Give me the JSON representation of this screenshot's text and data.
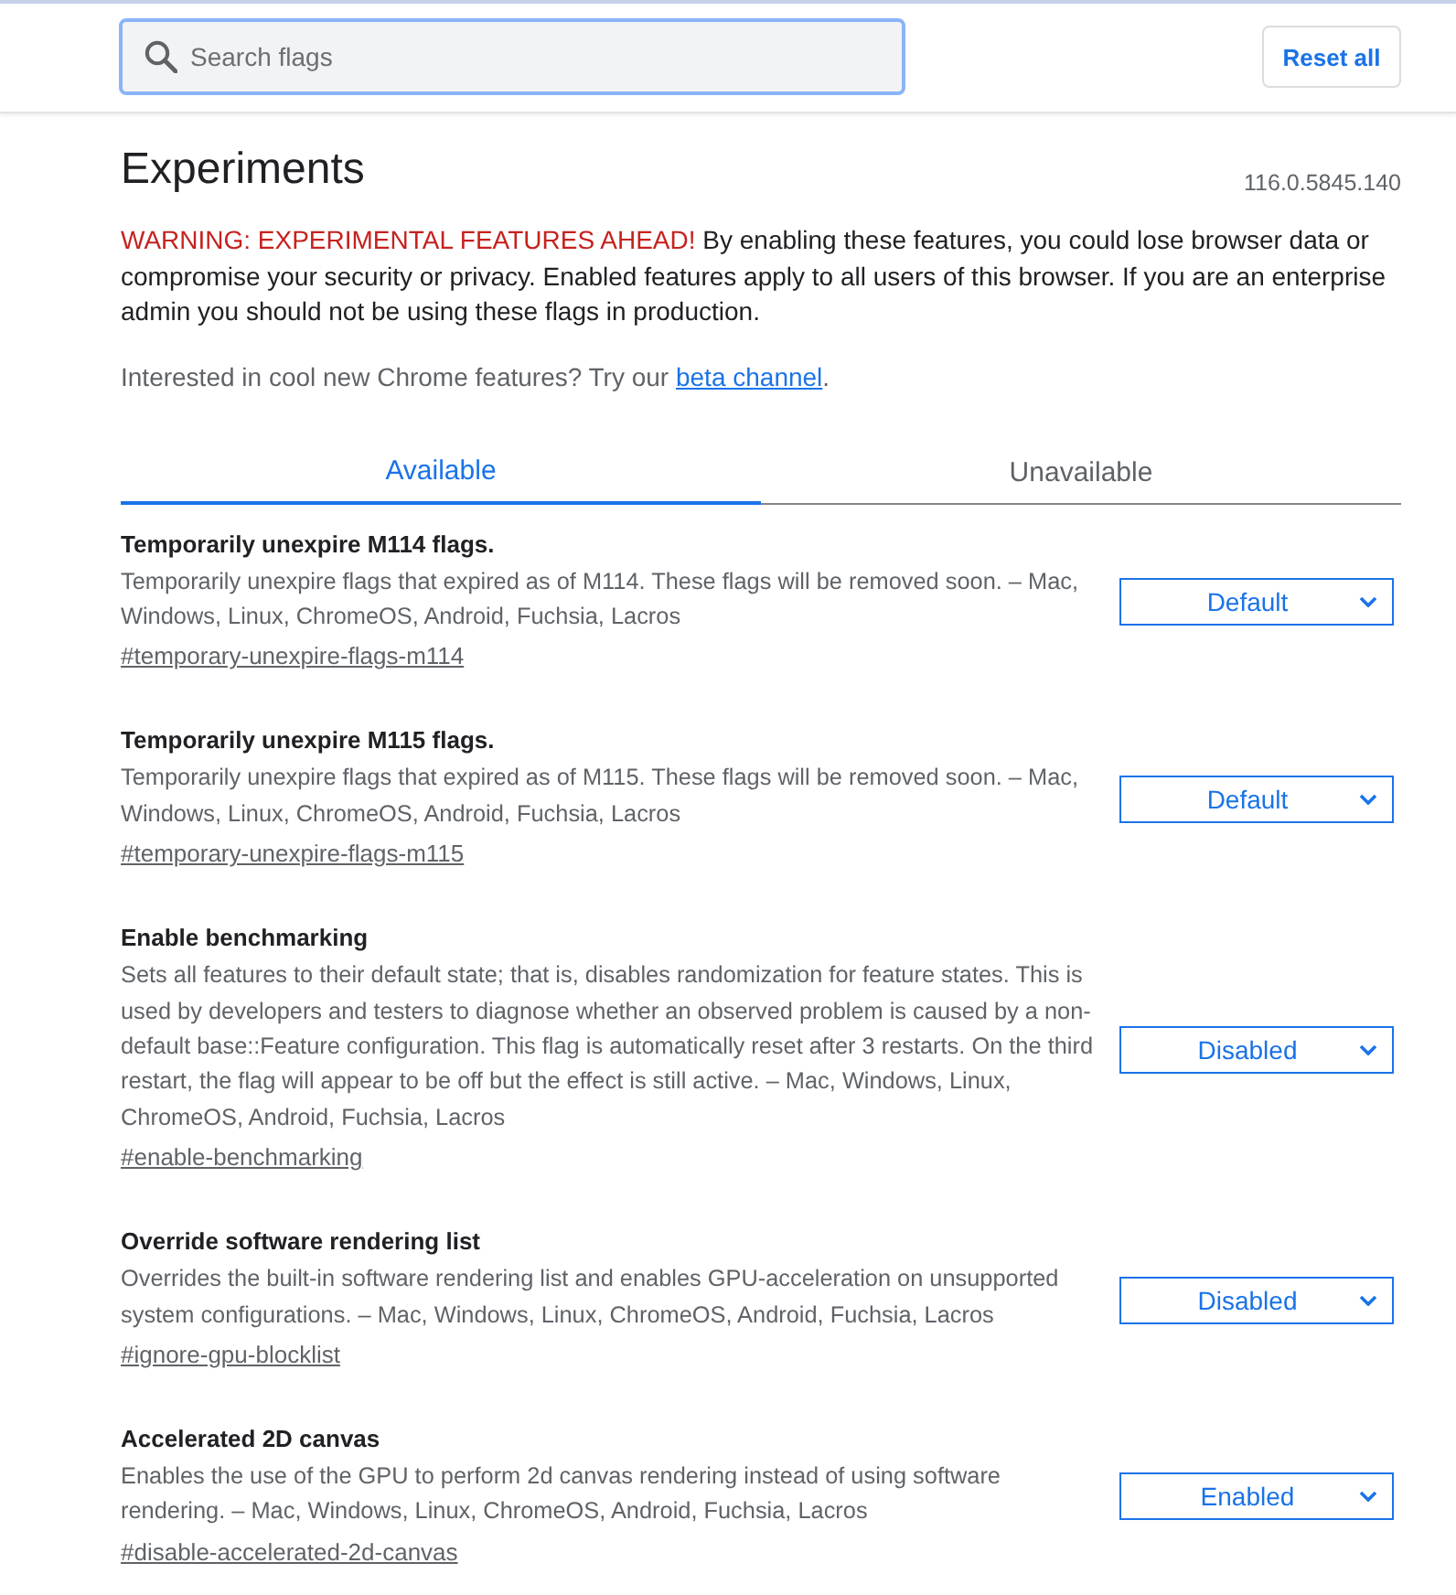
{
  "search": {
    "placeholder": "Search flags",
    "focused": true
  },
  "reset_button": "Reset all",
  "header": {
    "title": "Experiments",
    "version": "116.0.5845.140"
  },
  "warning": {
    "label": "WARNING: EXPERIMENTAL FEATURES AHEAD!",
    "text": "By enabling these features, you could lose browser data or compromise your security or privacy. Enabled features apply to all users of this browser. If you are an enterprise admin you should not be using these flags in production."
  },
  "promo": {
    "text": "Interested in cool new Chrome features? Try our",
    "link": "beta channel",
    "after": "."
  },
  "tabs": [
    {
      "label": "Available",
      "selected": true
    },
    {
      "label": "Unavailable",
      "selected": false
    }
  ],
  "flags": [
    {
      "title": "Temporarily unexpire M114 flags.",
      "description": "Temporarily unexpire flags that expired as of M114. These flags will be removed soon. – Mac, Windows, Linux, ChromeOS, Android, Fuchsia, Lacros",
      "link": "#temporary-unexpire-flags-m114",
      "value": "Default"
    },
    {
      "title": "Temporarily unexpire M115 flags.",
      "description": "Temporarily unexpire flags that expired as of M115. These flags will be removed soon. – Mac, Windows, Linux, ChromeOS, Android, Fuchsia, Lacros",
      "link": "#temporary-unexpire-flags-m115",
      "value": "Default"
    },
    {
      "title": "Enable benchmarking",
      "description": "Sets all features to their default state; that is, disables randomization for feature states. This is used by developers and testers to diagnose whether an observed problem is caused by a non-default base::Feature configuration. This flag is automatically reset after 3 restarts. On the third restart, the flag will appear to be off but the effect is still active. – Mac, Windows, Linux, ChromeOS, Android, Fuchsia, Lacros",
      "link": "#enable-benchmarking",
      "value": "Disabled"
    },
    {
      "title": "Override software rendering list",
      "description": "Overrides the built-in software rendering list and enables GPU-acceleration on unsupported system configurations. – Mac, Windows, Linux, ChromeOS, Android, Fuchsia, Lacros",
      "link": "#ignore-gpu-blocklist",
      "value": "Disabled"
    },
    {
      "title": "Accelerated 2D canvas",
      "description": "Enables the use of the GPU to perform 2d canvas rendering instead of using software rendering. – Mac, Windows, Linux, ChromeOS, Android, Fuchsia, Lacros",
      "link": "#disable-accelerated-2d-canvas",
      "value": "Enabled"
    }
  ]
}
